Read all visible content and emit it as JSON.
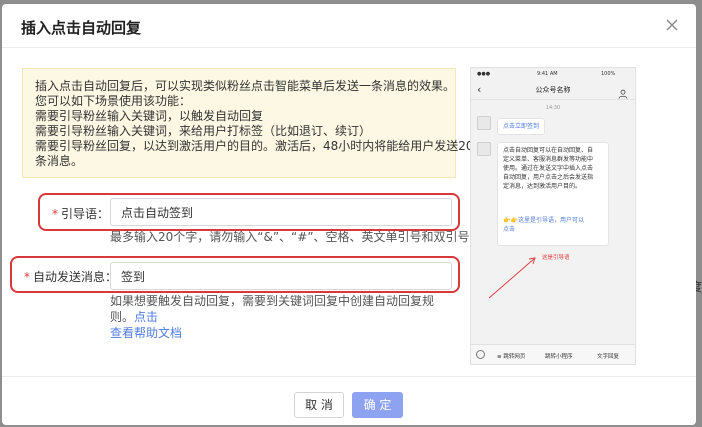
{
  "dialog": {
    "title": "插入点击自动回复",
    "close_icon": "close-icon"
  },
  "notice": {
    "lines": [
      "插入点击自动回复后，可以实现类似粉丝点击智能菜单后发送一条消息的效果。",
      "您可以如下场景使用该功能：",
      "需要引导粉丝输入关键词，以触发自动回复",
      "需要引导粉丝输入关键词，来给用户打标签（比如退订、续订）",
      "需要引导粉丝回复，以达到激活用户的目的。激活后，48小时内将能给用户发送20",
      "条消息。"
    ]
  },
  "form": {
    "guide": {
      "required_mark": "*",
      "label": "引导语：",
      "value": "点击自动签到",
      "help": "最多输入20个字，请勿输入“&”、“#”、空格、英文单引号和双引号"
    },
    "auto_message": {
      "required_mark": "*",
      "label": "自动发送消息：",
      "value": "签到",
      "help_prefix": "如果想要触发自动回复，需要到关键词回复中创建自动回复规则。",
      "help_link_1": "点击",
      "help_link_2": "查看帮助文档"
    }
  },
  "phone_preview": {
    "status_time": "9:41 AM",
    "status_battery": "100%",
    "back_icon": "chevron-left-icon",
    "title": "公众号名称",
    "user_icon": "person-icon",
    "timestamp": "14:30",
    "user_message": "点击立即签到",
    "reply_lines": [
      "点击自动回复可以在自动回复、自",
      "定义菜单、客服消息群发等功能中",
      "使用。通过在发送文字中插入点击",
      "自动回复，用户点击之后会发送指",
      "定消息，达到激活用户目的。"
    ],
    "reply_link": "👉👉这里是引导语，用户可以",
    "reply_link_2": "点击",
    "guide_annotation": "这是引导语",
    "bottom_menu": [
      "≡ 跳转网页",
      "跳转小程序",
      "文字回复"
    ]
  },
  "footer": {
    "cancel_label": "取 消",
    "ok_label": "确 定"
  },
  "colors": {
    "primary": "#8ea2f2",
    "highlight_box": "#d9383a",
    "required": "#e4393c",
    "link": "#4f7ce6",
    "notice_bg": "#fdf8e4"
  },
  "background_fragment": "度"
}
